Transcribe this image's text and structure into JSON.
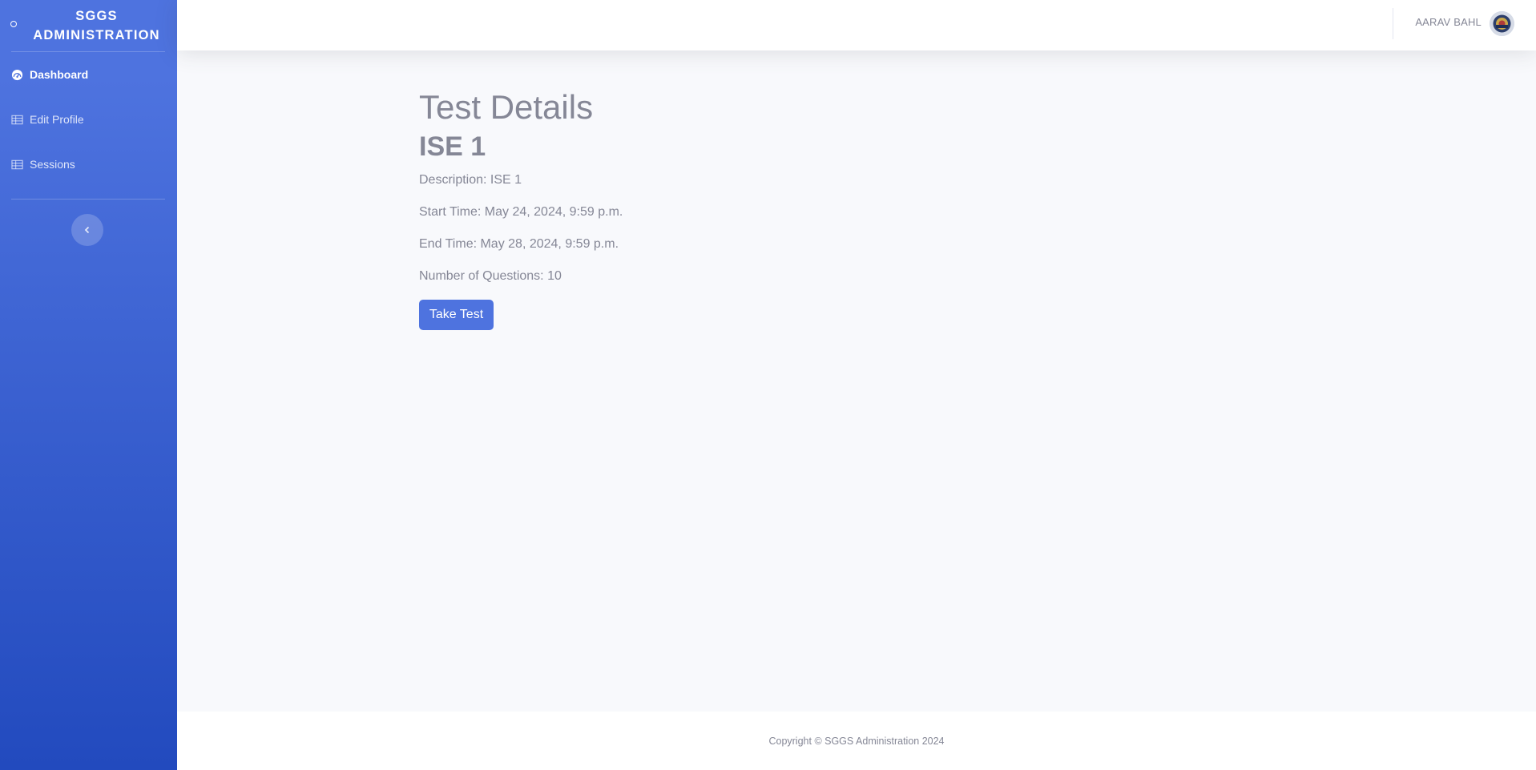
{
  "sidebar": {
    "brand": "SGGS Administration",
    "items": [
      {
        "label": "Dashboard",
        "icon": "tachometer-icon",
        "active": true
      },
      {
        "label": "Edit Profile",
        "icon": "table-icon",
        "active": false
      },
      {
        "label": "Sessions",
        "icon": "table-icon",
        "active": false
      }
    ],
    "toggle_icon": "chevron-left-icon"
  },
  "topbar": {
    "user_name": "AARAV BAHL"
  },
  "main": {
    "title": "Test Details",
    "test_name": "ISE 1",
    "description": "Description: ISE 1",
    "start_time": "Start Time: May 24, 2024, 9:59 p.m.",
    "end_time": "End Time: May 28, 2024, 9:59 p.m.",
    "num_questions": "Number of Questions: 10",
    "take_test_label": "Take Test"
  },
  "footer": {
    "copyright": "Copyright © SGGS Administration 2024"
  },
  "colors": {
    "primary": "#4e73df",
    "sidebar_gradient_end": "#224abe",
    "background": "#f8f9fc",
    "text": "#858796"
  }
}
